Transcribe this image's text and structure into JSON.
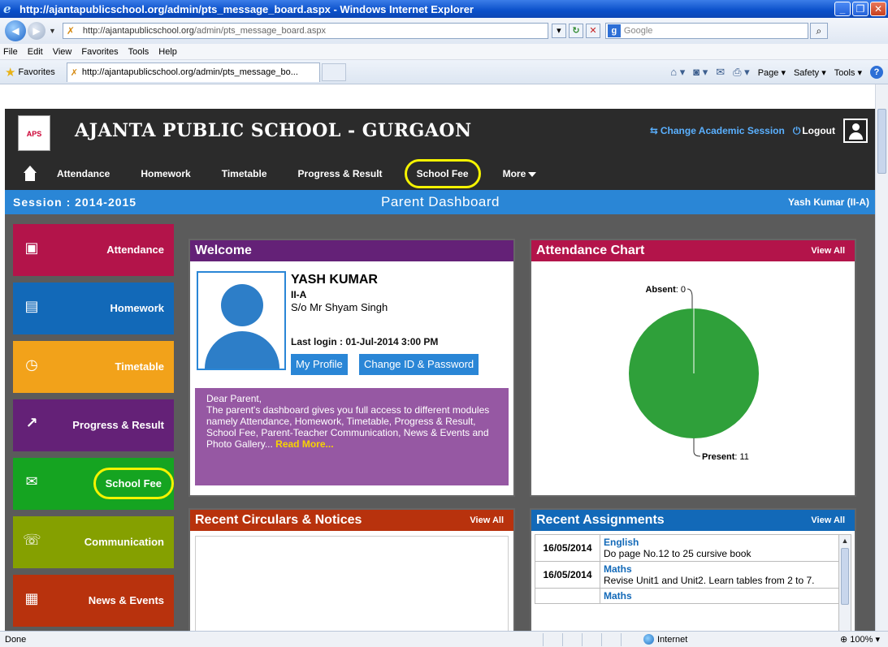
{
  "browser": {
    "title": "http://ajantapublicschool.org/admin/pts_message_board.aspx - Windows Internet Explorer",
    "url_host": "http://ajantapublicschool.org",
    "url_path": "/admin/pts_message_board.aspx",
    "search_placeholder": "Google",
    "menu": [
      "File",
      "Edit",
      "View",
      "Favorites",
      "Tools",
      "Help"
    ],
    "favorites_label": "Favorites",
    "tab_title": "http://ajantapublicschool.org/admin/pts_message_bo...",
    "commands": [
      "Page",
      "Safety",
      "Tools"
    ],
    "status": "Done",
    "zone": "Internet",
    "zoom": "100%"
  },
  "header": {
    "school_name": "AJANTA PUBLIC SCHOOL - GURGAON",
    "change_session": "Change Academic Session",
    "logout": "Logout",
    "logo_text": "APS"
  },
  "topnav": {
    "items": [
      "Attendance",
      "Homework",
      "Timetable",
      "Progress & Result",
      "School Fee",
      "More"
    ]
  },
  "sessionbar": {
    "session": "Session : 2014-2015",
    "dashboard": "Parent Dashboard",
    "student": "Yash Kumar (II-A)"
  },
  "sidebar": {
    "items": [
      {
        "label": "Attendance",
        "icon": "desk-icon"
      },
      {
        "label": "Homework",
        "icon": "book-icon"
      },
      {
        "label": "Timetable",
        "icon": "calendar-clock-icon"
      },
      {
        "label": "Progress & Result",
        "icon": "chart-icon"
      },
      {
        "label": "School Fee",
        "icon": "money-icon"
      },
      {
        "label": "Communication",
        "icon": "chat-icon"
      },
      {
        "label": "News & Events",
        "icon": "news-icon"
      }
    ]
  },
  "welcome": {
    "title": "Welcome",
    "name": "YASH KUMAR",
    "class": "II-A",
    "parent": "S/o Mr Shyam Singh",
    "last_login": "Last login : 01-Jul-2014 3:00 PM",
    "profile_btn": "My Profile",
    "password_btn": "Change ID & Password",
    "notice_greeting": "Dear Parent,",
    "notice_body": "The parent's dashboard gives you full access to different modules namely Attendance, Homework, Timetable, Progress & Result, School Fee, Parent-Teacher Communication, News & Events and Photo Gallery...",
    "read_more": "Read More..."
  },
  "attendance": {
    "title": "Attendance Chart",
    "view_all": "View All",
    "absent_label": "Absent",
    "present_label": "Present"
  },
  "chart_data": {
    "type": "pie",
    "categories": [
      "Absent",
      "Present"
    ],
    "values": [
      0,
      11
    ],
    "colors": [
      "#8a8a8a",
      "#2fa03a"
    ]
  },
  "circulars": {
    "title": "Recent Circulars & Notices",
    "view_all": "View All"
  },
  "assignments": {
    "title": "Recent Assignments",
    "view_all": "View All",
    "rows": [
      {
        "date": "16/05/2014",
        "subject": "English",
        "desc": "Do page No.12 to 25 cursive book"
      },
      {
        "date": "16/05/2014",
        "subject": "Maths",
        "desc": "Revise Unit1 and Unit2. Learn tables from 2 to 7."
      },
      {
        "date": "",
        "subject": "Maths",
        "desc": ""
      }
    ]
  }
}
